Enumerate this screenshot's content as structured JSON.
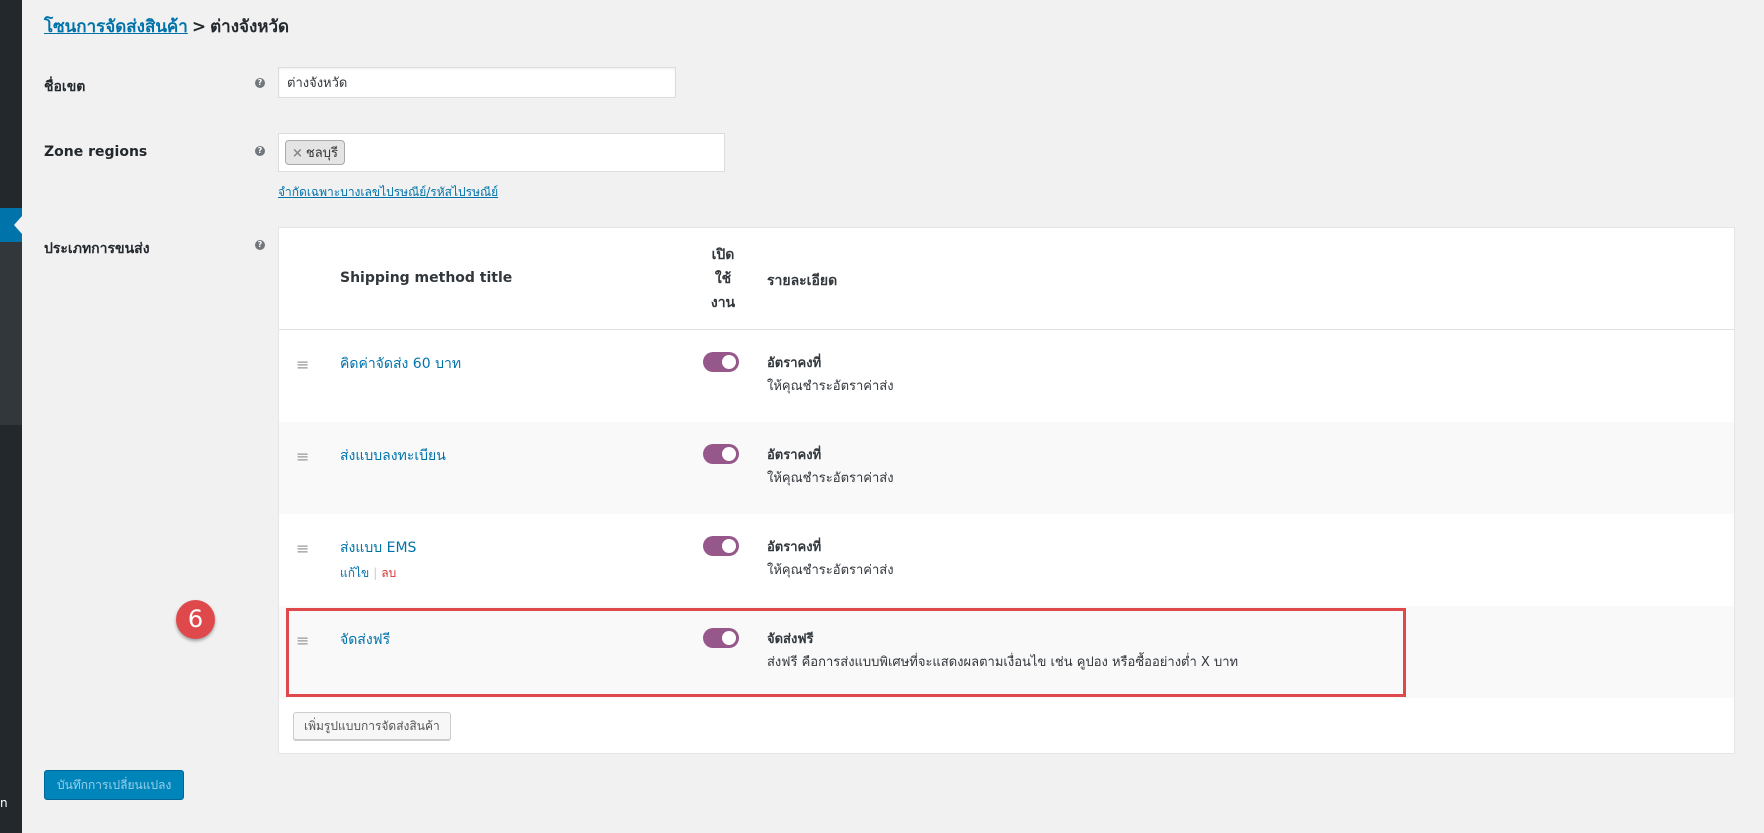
{
  "breadcrumb": {
    "parent": "โซนการจัดส่งสินค้า",
    "separator": ">",
    "current": "ต่างจังหวัด"
  },
  "zone_name": {
    "label": "ชื่อเขต",
    "value": "ต่างจังหวัด"
  },
  "zone_regions": {
    "label": "Zone regions",
    "chips": [
      {
        "remove": "×",
        "label": "ชลบุรี"
      }
    ],
    "limit_link": "จำกัดเฉพาะบางเลขไปรษณีย์/รหัสไปรษณีย์"
  },
  "shipping_methods": {
    "label": "ประเภทการขนส่ง",
    "columns": {
      "title": "Shipping method title",
      "enabled": "เปิด ใช้ งาน",
      "description": "รายละเอียด"
    },
    "rows": [
      {
        "title": "คิดค่าจัดส่ง 60 บาท",
        "enabled": true,
        "type": "อัตราคงที่",
        "description": "ให้คุณชำระอัตราค่าส่ง"
      },
      {
        "title": "ส่งแบบลงทะเบียน",
        "enabled": true,
        "type": "อัตราคงที่",
        "description": "ให้คุณชำระอัตราค่าส่ง"
      },
      {
        "title": "ส่งแบบ EMS",
        "enabled": true,
        "type": "อัตราคงที่",
        "description": "ให้คุณชำระอัตราค่าส่ง",
        "actions": {
          "edit": "แก้ไข",
          "sep": "|",
          "delete": "ลบ"
        }
      },
      {
        "title": "จัดส่งฟรี",
        "enabled": true,
        "type": "จัดส่งฟรี",
        "description": "ส่งฟรี คือการส่งแบบพิเศษที่จะแสดงผลตามเงื่อนไข เช่น คูปอง หรือซื้ออย่างต่ำ X บาท"
      }
    ],
    "add_button": "เพิ่มรูปแบบการจัดส่งสินค้า"
  },
  "step_badge": "6",
  "save_button": "บันทึกการเปลี่ยนแปลง",
  "sidebar_glyph": "n",
  "help_glyph": "?",
  "drag_glyph": "≡",
  "colors": {
    "link": "#0073aa",
    "toggle_on": "#96588a",
    "highlight": "#e0494b",
    "primary_button": "#0085ba",
    "delete": "#dc3232"
  }
}
